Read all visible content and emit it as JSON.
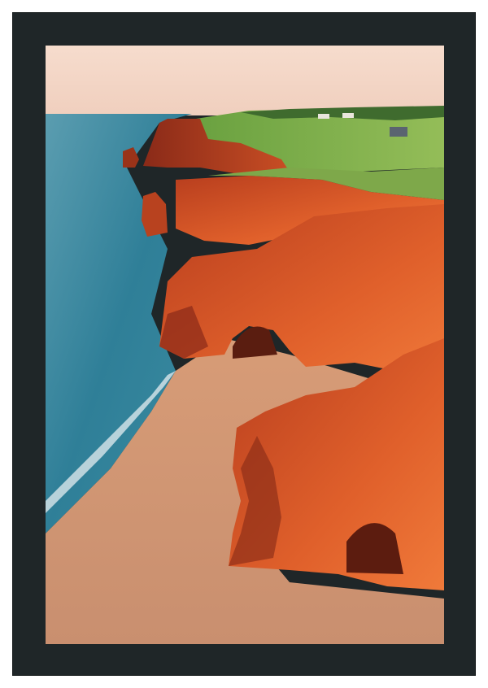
{
  "artwork": {
    "subject": "",
    "frame_color": "#1f2628",
    "sky_color": "#f3d7c8",
    "sea_color": "#2f7f98",
    "cliff_color": "#d8542a",
    "sand_color": "#d8a07a",
    "grass_color": "#7fb04a"
  }
}
